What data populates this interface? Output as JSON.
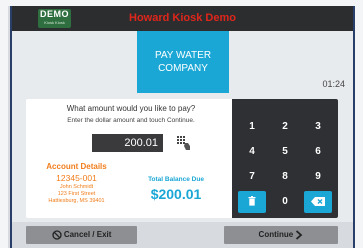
{
  "header": {
    "logo_text": "DEMO",
    "logo_subtext": "Kiosk Kiosk",
    "title": "Howard Kiosk Demo"
  },
  "biller": {
    "line1": "PAY WATER",
    "line2": "COMPANY"
  },
  "timer": "01:24",
  "prompt": "What amount would you like to pay?",
  "instruction": "Enter the dollar amount and touch Continue.",
  "amount_value": "200.01",
  "account": {
    "heading": "Account Details",
    "number": "12345-001",
    "name": "John Schmidt",
    "street": "123 First Street",
    "city": "Hattiesburg, MS 39401"
  },
  "balance": {
    "label": "Total Balance Due",
    "value": "$200.01"
  },
  "keypad": {
    "keys": [
      "1",
      "2",
      "3",
      "4",
      "5",
      "6",
      "7",
      "8",
      "9",
      "0"
    ]
  },
  "buttons": {
    "cancel": "Cancel / Exit",
    "continue": "Continue"
  },
  "icons": {
    "trash": "trash-icon",
    "backspace": "backspace-icon",
    "cancel": "cancel-icon",
    "continue": "chevron-right-icon",
    "keypad_hand": "keypad-hand-icon"
  },
  "colors": {
    "accent": "#1ba7d6",
    "account_text": "#f07d1b",
    "title_red": "#e0261b",
    "keypad_bg": "#2f3034"
  }
}
